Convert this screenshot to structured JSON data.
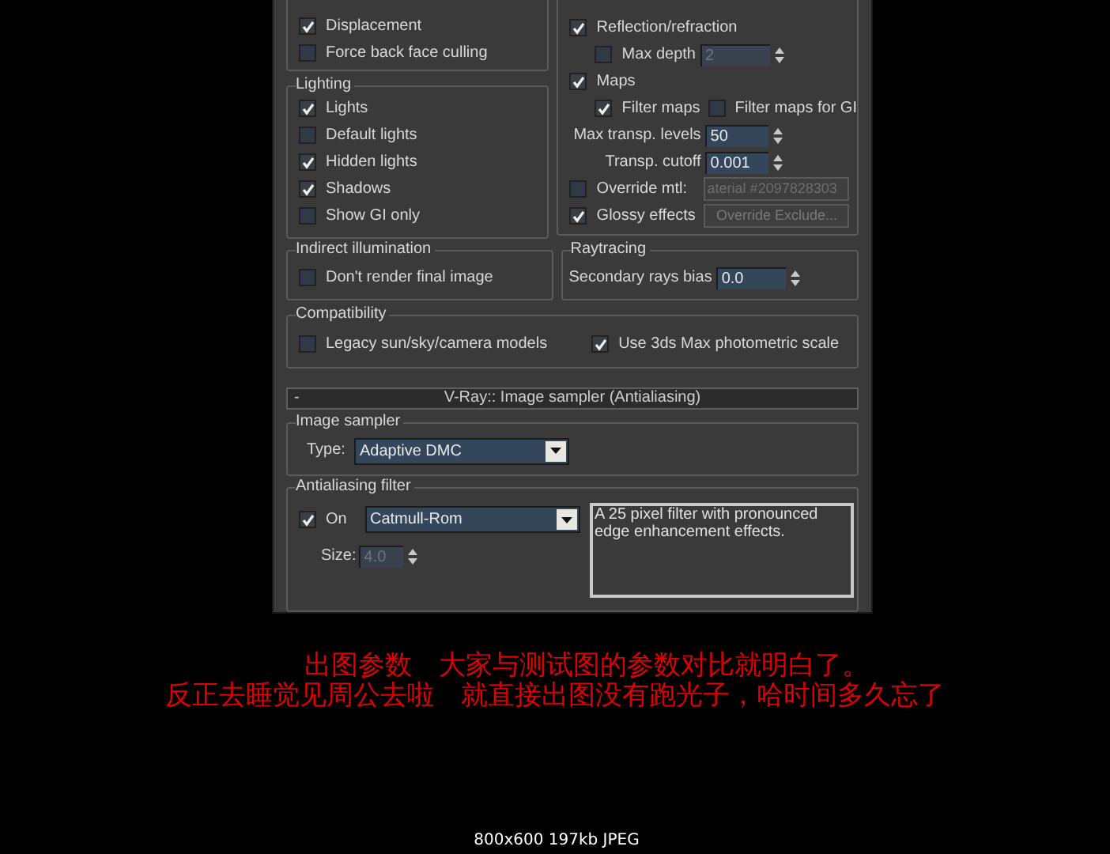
{
  "geometry": {
    "options": [
      {
        "label": "Displacement",
        "checked": true
      },
      {
        "label": "Force back face culling",
        "checked": false
      }
    ]
  },
  "lighting": {
    "title": "Lighting",
    "options": [
      {
        "label": "Lights",
        "checked": true
      },
      {
        "label": "Default lights",
        "checked": false
      },
      {
        "label": "Hidden lights",
        "checked": true
      },
      {
        "label": "Shadows",
        "checked": true
      },
      {
        "label": "Show GI only",
        "checked": false
      }
    ]
  },
  "indirect_illumination": {
    "title": "Indirect illumination",
    "options": [
      {
        "label": "Don't render final image",
        "checked": false
      }
    ]
  },
  "materials": {
    "reflection": {
      "label": "Reflection/refraction",
      "checked": true
    },
    "max_depth": {
      "label": "Max depth",
      "checked": false,
      "value": "2",
      "disabled": true
    },
    "maps": {
      "label": "Maps",
      "checked": true
    },
    "filter_maps": {
      "label": "Filter maps",
      "checked": true
    },
    "filter_maps_gi": {
      "label": "Filter maps for GI",
      "checked": false
    },
    "max_transp_levels": {
      "label": "Max transp. levels",
      "value": "50",
      "disabled": false
    },
    "transp_cutoff": {
      "label": "Transp. cutoff",
      "value": "0.001",
      "disabled": false
    },
    "override_mtl": {
      "label": "Override mtl:",
      "checked": false,
      "value": "aterial #2097828303"
    },
    "glossy_effects": {
      "label": "Glossy effects",
      "checked": true,
      "button": "Override Exclude..."
    }
  },
  "raytracing": {
    "title": "Raytracing",
    "label": "Secondary rays bias",
    "value": "0.0",
    "disabled": false
  },
  "compatibility": {
    "title": "Compatibility",
    "options": [
      {
        "label": "Legacy sun/sky/camera models",
        "checked": false
      },
      {
        "label": "Use 3ds Max photometric scale",
        "checked": true
      }
    ]
  },
  "rollout": {
    "toggle": "-",
    "title": "V-Ray:: Image sampler (Antialiasing)"
  },
  "image_sampler": {
    "title": "Image sampler",
    "type_label": "Type:",
    "type_value": "Adaptive DMC"
  },
  "antialiasing_filter": {
    "title": "Antialiasing filter",
    "on": {
      "label": "On",
      "checked": true
    },
    "filter": "Catmull-Rom",
    "description": "A 25 pixel filter with pronounced edge enhancement effects.",
    "size_label": "Size:",
    "size_value": "4.0",
    "size_disabled": true
  },
  "caption": [
    "出图参数　大家与测试图的参数对比就明白了。",
    "反正去睡觉见周公去啦　就直接出图没有跑光子，哈时间多久忘了"
  ],
  "viewer_info": "800x600 197kb JPEG"
}
